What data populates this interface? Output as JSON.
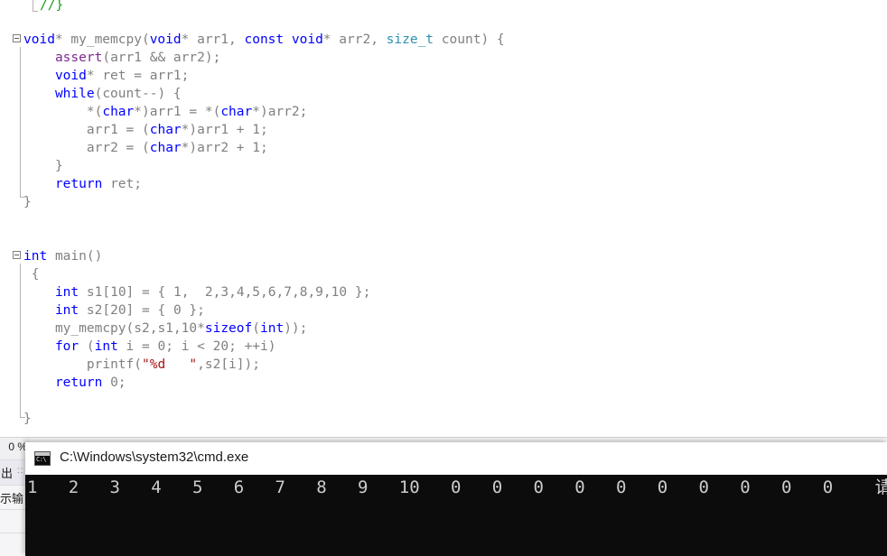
{
  "editor": {
    "change_bar_color": "#12b83c",
    "background": "#ffffff",
    "lines": [
      {
        "indent": 0,
        "text": "//}"
      },
      {
        "indent": 0,
        "text": ""
      },
      {
        "indent": 0,
        "text": "void* my_memcpy(void* arr1, const void* arr2, size_t count) {"
      },
      {
        "indent": 0,
        "text": "    assert(arr1 && arr2);"
      },
      {
        "indent": 0,
        "text": "    void* ret = arr1;"
      },
      {
        "indent": 0,
        "text": "    while(count--) {"
      },
      {
        "indent": 0,
        "text": "        *(char*)arr1 = *(char*)arr2;"
      },
      {
        "indent": 0,
        "text": "        arr1 = (char*)arr1 + 1;"
      },
      {
        "indent": 0,
        "text": "        arr2 = (char*)arr2 + 1;"
      },
      {
        "indent": 0,
        "text": "    }"
      },
      {
        "indent": 0,
        "text": "    return ret;"
      },
      {
        "indent": 0,
        "text": "}"
      },
      {
        "indent": 0,
        "text": ""
      },
      {
        "indent": 0,
        "text": ""
      },
      {
        "indent": 0,
        "text": "int main()"
      },
      {
        "indent": 0,
        "text": " {"
      },
      {
        "indent": 0,
        "text": "    int s1[10] = { 1,  2,3,4,5,6,7,8,9,10 };"
      },
      {
        "indent": 0,
        "text": "    int s2[20] = { 0 };"
      },
      {
        "indent": 0,
        "text": "    my_memcpy(s2,s1,10*sizeof(int));"
      },
      {
        "indent": 0,
        "text": "    for (int i = 0; i < 20; ++i)"
      },
      {
        "indent": 0,
        "text": "        printf(\"%d   \",s2[i]);"
      },
      {
        "indent": 0,
        "text": "    return 0;"
      },
      {
        "indent": 0,
        "text": ""
      },
      {
        "indent": 0,
        "text": "}"
      }
    ]
  },
  "ide_bottom": {
    "zoom_label": "0 %",
    "output_tab_label": "出",
    "output_tab_dots": "::",
    "output_source_label": "示输"
  },
  "console": {
    "icon_name": "cmd-exe-icon",
    "icon_glyph": "C:\\",
    "title": "C:\\Windows\\system32\\cmd.exe",
    "values": [
      1,
      2,
      3,
      4,
      5,
      6,
      7,
      8,
      9,
      10,
      0,
      0,
      0,
      0,
      0,
      0,
      0,
      0,
      0,
      0
    ],
    "prompt": "请按任意键继续.",
    "background": "#0c0c0c",
    "foreground": "#cccccc"
  }
}
